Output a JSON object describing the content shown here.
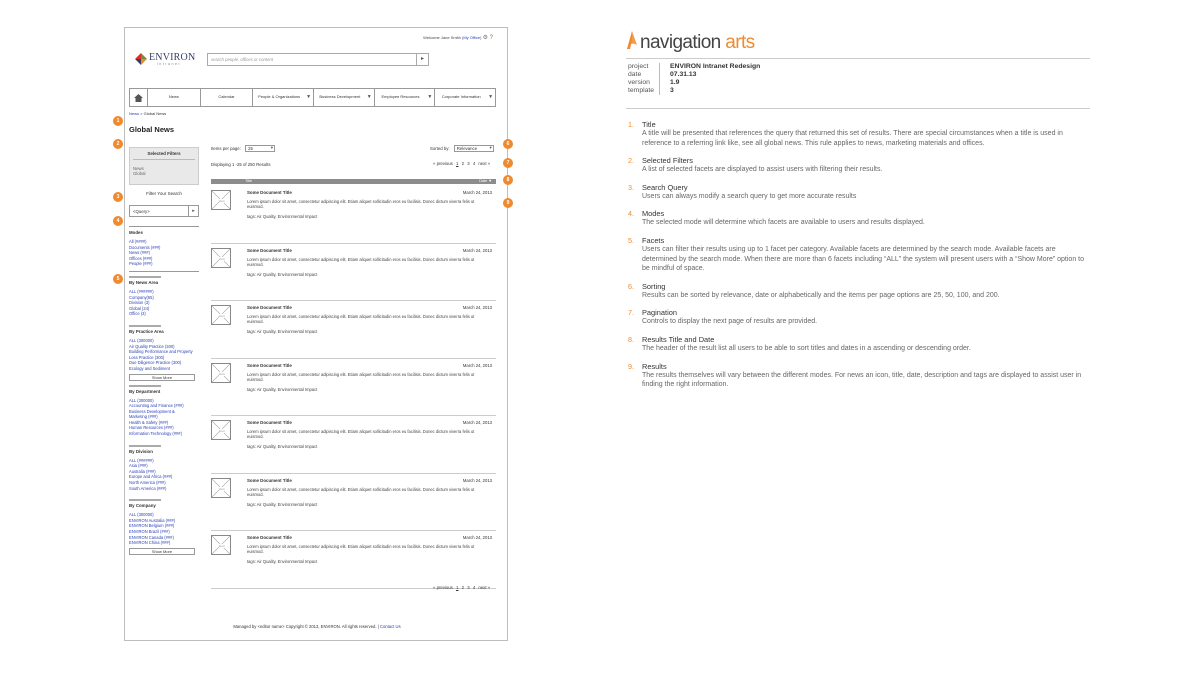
{
  "colors": {
    "accent": "#f08a2e",
    "link": "#2a3fb5",
    "header_bar": "#8c8c8c",
    "logo_red": "#d6322b"
  },
  "wireframe": {
    "welcome": {
      "prefix": "Welcome Jane Smith",
      "link": "(My Office)",
      "tools": "⚙ ?"
    },
    "logo": {
      "name": "ENVIRON",
      "sub": "intranet"
    },
    "search": {
      "placeholder": "search people, offices or content",
      "button_icon": "arrow-right-icon"
    },
    "nav": {
      "home_icon": "home-icon",
      "items": [
        {
          "label": "News",
          "dropdown": false
        },
        {
          "label": "Calendar",
          "dropdown": false
        },
        {
          "label": "People & Organizations",
          "dropdown": true
        },
        {
          "label": "Business Development",
          "dropdown": true
        },
        {
          "label": "Employee Resources",
          "dropdown": true
        },
        {
          "label": "Corporate Information",
          "dropdown": true
        }
      ]
    },
    "breadcrumb": {
      "link": "News",
      "sep": " > ",
      "current": "Global News"
    },
    "page_title": "Global News",
    "selected_filters": {
      "header": "Selected Filters",
      "line1": "News",
      "line2": "Global"
    },
    "filter_label": "Filter Your Search",
    "query": {
      "value": "<Query>"
    },
    "modes": {
      "header": "Modes",
      "items": [
        "All (####)",
        "Documents (###)",
        "News (###)",
        "Offices (###)",
        "People (###)"
      ]
    },
    "facet_groups": [
      {
        "header": "By News Area",
        "items": [
          "ALL (######)",
          "Company(55)",
          "Division (3)",
          "Global (24)",
          "Office (3)"
        ],
        "show_more": ""
      },
      {
        "header": "By Practice Area",
        "items": [
          "ALL (300000)",
          "Air Quality Practice (300)",
          "Building Performance and Property",
          "Loss Practice (300)",
          "Due Diligence Practice (300)",
          "Ecology and Sediment"
        ],
        "show_more": "Show More"
      },
      {
        "header": "By Department",
        "items": [
          "ALL (300000)",
          "Accounting and Finance (###)",
          "Business Development &",
          "Marketing (###)",
          "Health & Safety (###)",
          "Human Resources (###)",
          "Information Technology (###)"
        ],
        "show_more": ""
      },
      {
        "header": "By Division",
        "items": [
          "ALL (######)",
          "Asia (###)",
          "Australia (###)",
          "Europe and Africa (###)",
          "North America (###)",
          "South America (###)"
        ],
        "show_more": ""
      },
      {
        "header": "By Company",
        "items": [
          "ALL (300000)",
          "ENVIRON Australia (###)",
          "ENVIRON Belgium (###)",
          "ENVIRON Brazil (###)",
          "ENVIRON Canada (###)",
          "ENVIRON China (###)"
        ],
        "show_more": "Show More"
      }
    ],
    "items_per_page": {
      "label": "Items per page:",
      "value": "25"
    },
    "sorted_by": {
      "label": "Sorted by:",
      "value": "Relevance"
    },
    "displaying": "Displaying 1 -25 of 250 Results",
    "pager": {
      "prev": "« previous",
      "pages": [
        "1",
        "2",
        "3",
        "4"
      ],
      "next": "next »"
    },
    "results_header": {
      "title": "Title",
      "date": "Date ▼"
    },
    "results": [
      {
        "title": "Some Document Title",
        "date": "March 24, 2013",
        "desc": "Lorem ipsum dolor sit amet, consectetur adipiscing elit. Etiam aliquet sollicitudin eros eu facilisis. Donec dictum viverra felis ut euismod.",
        "tags": "tags: Air Quality, Environmental Impact",
        "thumb": "icon"
      },
      {
        "title": "Some Document Title",
        "date": "March 24, 2013",
        "desc": "Lorem ipsum dolor sit amet, consectetur adipiscing elit. Etiam aliquet sollicitudin eros eu facilisis. Donec dictum viverra felis ut euismod.",
        "tags": "tags: Air Quality, Environmental Impact",
        "thumb": "icon"
      },
      {
        "title": "Some Document Title",
        "date": "March 24, 2013",
        "desc": "Lorem ipsum dolor sit amet, consectetur adipiscing elit. Etiam aliquet sollicitudin eros eu facilisis. Donec dictum viverra felis ut euismod.",
        "tags": "tags: Air Quality, Environmental Impact",
        "thumb": "icon"
      },
      {
        "title": "Some Document Title",
        "date": "March 24, 2013",
        "desc": "Lorem ipsum dolor sit amet, consectetur adipiscing elit. Etiam aliquet sollicitudin eros eu facilisis. Donec dictum viverra felis ut euismod.",
        "tags": "tags: Air Quality, Environmental Impact",
        "thumb": "icon"
      },
      {
        "title": "Some Document Title",
        "date": "March 24, 2013",
        "desc": "Lorem ipsum dolor sit amet, consectetur adipiscing elit. Etiam aliquet sollicitudin eros eu facilisis. Donec dictum viverra felis ut euismod.",
        "tags": "tags: Air Quality, Environmental Impact",
        "thumb": "icon"
      },
      {
        "title": "Some Document Title",
        "date": "March 24, 2013",
        "desc": "Lorem ipsum dolor sit amet, consectetur adipiscing elit. Etiam aliquet sollicitudin eros eu facilisis. Donec dictum viverra felis ut euismod.",
        "tags": "tags: Air Quality, Environmental Impact",
        "thumb": "icon"
      },
      {
        "title": "Some Document Title",
        "date": "March 24, 2013",
        "desc": "Lorem ipsum dolor sit amet, consectetur adipiscing elit. Etiam aliquet sollicitudin eros eu facilisis. Donec dictum viverra felis ut euismod.",
        "tags": "tags: Air Quality, Environmental Impact",
        "thumb": "icon"
      }
    ],
    "footer": {
      "text": "Managed by <editor name>   Copyright © 2013, ENVIRON. All rights reserved.  |",
      "link": "Contact Us"
    },
    "badges": [
      "1",
      "2",
      "3",
      "4",
      "5",
      "6",
      "7",
      "8",
      "9"
    ]
  },
  "annotations": {
    "brand": {
      "part1": "navigation",
      "part2": " arts"
    },
    "meta": [
      {
        "key": "project",
        "value": "ENVIRON Intranet Redesign"
      },
      {
        "key": "date",
        "value": "07.31.13"
      },
      {
        "key": "version",
        "value": "1.9"
      },
      {
        "key": "template",
        "value": "3"
      }
    ],
    "notes": [
      {
        "num": "1.",
        "title": "Title",
        "desc": "A title will be presented that references the query that returned this set of results. There are special circumstances when a title is used in reference to a referring link like, see all global news. This rule applies to news, marketing materials and offices."
      },
      {
        "num": "2.",
        "title": "Selected Filters",
        "desc": "A list of selected facets are displayed to assist users with filtering their results."
      },
      {
        "num": "3.",
        "title": "Search Query",
        "desc": "Users can always modify a search query to get more accurate results"
      },
      {
        "num": "4.",
        "title": "Modes",
        "desc": "The selected mode will determine which facets are available to users and results displayed."
      },
      {
        "num": "5.",
        "title": "Facets",
        "desc": "Users can filter their results using up to 1 facet per category. Available facets are determined by the search mode. Available facets are determined by the search mode. When there are more than 6 facets including “ALL” the system will present users with a “Show More” option to be mindful of space."
      },
      {
        "num": "6.",
        "title": "Sorting",
        "desc": "Results can be sorted by relevance, date or alphabetically and the items per page options are 25, 50, 100, and 200."
      },
      {
        "num": "7.",
        "title": "Pagination",
        "desc": "Controls to display the next page of results are provided."
      },
      {
        "num": "8.",
        "title": "Results Title and Date",
        "desc": "The header of the result list all users to be able to sort titles and dates in a ascending or descending order."
      },
      {
        "num": "9.",
        "title": "Results",
        "desc": "The results themselves will vary between the different modes. For news an icon, title, date, description and tags are displayed to assist user in finding the right information."
      }
    ]
  }
}
